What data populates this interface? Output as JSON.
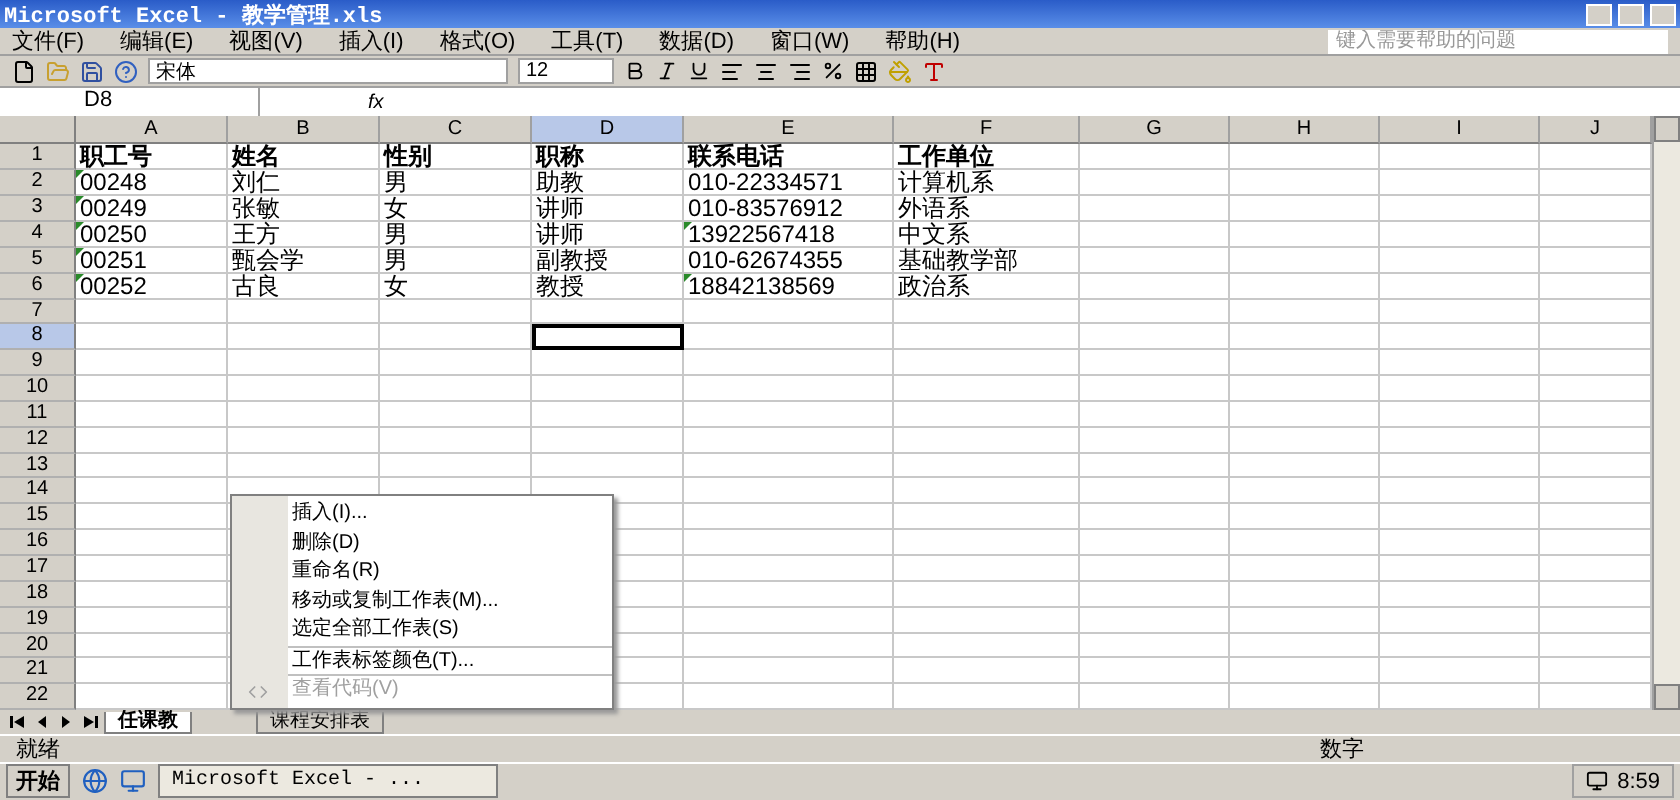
{
  "window": {
    "title": "Microsoft Excel - 教学管理.xls"
  },
  "menu": [
    "文件(F)",
    "编辑(E)",
    "视图(V)",
    "插入(I)",
    "格式(O)",
    "工具(T)",
    "数据(D)",
    "窗口(W)",
    "帮助(H)"
  ],
  "help_search": {
    "placeholder": "键入需要帮助的问题"
  },
  "toolbar": {
    "font": "宋体",
    "size": "12"
  },
  "formula_bar": {
    "name_box": "D8",
    "fx": "fx"
  },
  "columns": [
    {
      "label": "A",
      "selected": false
    },
    {
      "label": "B",
      "selected": false
    },
    {
      "label": "C",
      "selected": false
    },
    {
      "label": "D",
      "selected": true
    },
    {
      "label": "E",
      "selected": false
    },
    {
      "label": "F",
      "selected": false
    },
    {
      "label": "G",
      "selected": false
    },
    {
      "label": "H",
      "selected": false
    },
    {
      "label": "I",
      "selected": false
    },
    {
      "label": "J",
      "selected": false
    }
  ],
  "rows": [
    {
      "number": "1",
      "selected": false,
      "bold": true,
      "cells": [
        {
          "text": "职工号",
          "flag": false
        },
        {
          "text": "姓名",
          "flag": false
        },
        {
          "text": "性别",
          "flag": false
        },
        {
          "text": "职称",
          "flag": false
        },
        {
          "text": "联系电话",
          "flag": false
        },
        {
          "text": "工作单位",
          "flag": false
        }
      ]
    },
    {
      "number": "2",
      "selected": false,
      "bold": false,
      "cells": [
        {
          "text": "00248",
          "flag": true
        },
        {
          "text": "刘仁",
          "flag": false
        },
        {
          "text": "男",
          "flag": false
        },
        {
          "text": "助教",
          "flag": false
        },
        {
          "text": "010-22334571",
          "flag": false
        },
        {
          "text": "计算机系",
          "flag": false
        }
      ]
    },
    {
      "number": "3",
      "selected": false,
      "bold": false,
      "cells": [
        {
          "text": "00249",
          "flag": true
        },
        {
          "text": "张敏",
          "flag": false
        },
        {
          "text": "女",
          "flag": false
        },
        {
          "text": "讲师",
          "flag": false
        },
        {
          "text": "010-83576912",
          "flag": false
        },
        {
          "text": "外语系",
          "flag": false
        }
      ]
    },
    {
      "number": "4",
      "selected": false,
      "bold": false,
      "cells": [
        {
          "text": "00250",
          "flag": true
        },
        {
          "text": "王方",
          "flag": false
        },
        {
          "text": "男",
          "flag": false
        },
        {
          "text": "讲师",
          "flag": false
        },
        {
          "text": "13922567418",
          "flag": true
        },
        {
          "text": "中文系",
          "flag": false
        }
      ]
    },
    {
      "number": "5",
      "selected": false,
      "bold": false,
      "cells": [
        {
          "text": "00251",
          "flag": true
        },
        {
          "text": "甄会学",
          "flag": false
        },
        {
          "text": "男",
          "flag": false
        },
        {
          "text": "副教授",
          "flag": false
        },
        {
          "text": "010-62674355",
          "flag": false
        },
        {
          "text": "基础教学部",
          "flag": false
        }
      ]
    },
    {
      "number": "6",
      "selected": false,
      "bold": false,
      "cells": [
        {
          "text": "00252",
          "flag": true
        },
        {
          "text": "古良",
          "flag": false
        },
        {
          "text": "女",
          "flag": false
        },
        {
          "text": "教授",
          "flag": false
        },
        {
          "text": "18842138569",
          "flag": true
        },
        {
          "text": "政治系",
          "flag": false
        }
      ]
    },
    {
      "number": "7",
      "selected": false
    },
    {
      "number": "8",
      "selected": true
    },
    {
      "number": "9",
      "selected": false
    },
    {
      "number": "10",
      "selected": false
    },
    {
      "number": "11",
      "selected": false
    },
    {
      "number": "12",
      "selected": false
    },
    {
      "number": "13",
      "selected": false
    },
    {
      "number": "14",
      "selected": false
    },
    {
      "number": "15",
      "selected": false
    },
    {
      "number": "16",
      "selected": false
    },
    {
      "number": "17",
      "selected": false
    },
    {
      "number": "18",
      "selected": false
    },
    {
      "number": "19",
      "selected": false
    },
    {
      "number": "20",
      "selected": false
    },
    {
      "number": "21",
      "selected": false
    },
    {
      "number": "22",
      "selected": false
    }
  ],
  "sheet_tabs": [
    {
      "label": "任课教",
      "selected": true
    },
    {
      "label": "课程安排表",
      "selected": false
    }
  ],
  "context_menu": [
    {
      "label": "插入(I)...",
      "disabled": false,
      "separator_before": false
    },
    {
      "label": "删除(D)",
      "disabled": false,
      "separator_before": false
    },
    {
      "label": "重命名(R)",
      "disabled": false,
      "separator_before": false
    },
    {
      "label": "移动或复制工作表(M)...",
      "disabled": false,
      "separator_before": false
    },
    {
      "label": "选定全部工作表(S)",
      "disabled": false,
      "separator_before": false
    },
    {
      "label": "工作表标签颜色(T)...",
      "disabled": false,
      "separator_before": true
    },
    {
      "label": "查看代码(V)",
      "disabled": true,
      "separator_before": true
    }
  ],
  "status_bar": {
    "left": "就绪",
    "mode": "数字"
  },
  "taskbar": {
    "start": "开始",
    "task": "Microsoft Excel - ...",
    "clock": "8:59"
  }
}
